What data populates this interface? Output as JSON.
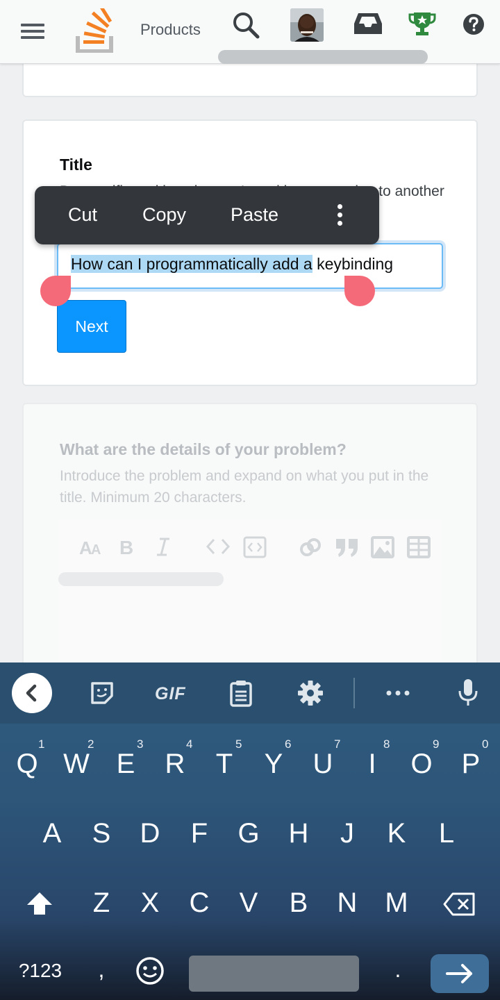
{
  "topbar": {
    "products_label": "Products",
    "icons": [
      "hamburger-menu-icon",
      "stackoverflow-logo",
      "search-icon",
      "user-avatar",
      "inbox-icon",
      "trophy-icon",
      "help-icon"
    ]
  },
  "title_section": {
    "heading": "Title",
    "description": "Be specific and imagine you're asking a question to another person.",
    "input_value_selected": "How can I programmatically add a",
    "input_value_rest": " keybinding",
    "next_label": "Next"
  },
  "context_menu": {
    "items": [
      "Cut",
      "Copy",
      "Paste"
    ],
    "more_icon": "more-vertical-icon"
  },
  "details_section": {
    "heading": "What are the details of your problem?",
    "description": "Introduce the problem and expand on what you put in the title. Minimum 20 characters.",
    "toolbar_icons": [
      "text-size-icon",
      "bold-icon",
      "italic-icon",
      "code-icon",
      "code-block-icon",
      "link-icon",
      "quote-icon",
      "image-icon",
      "table-icon"
    ]
  },
  "keyboard": {
    "toolbar_icons": [
      "back-icon",
      "sticker-icon",
      "gif-icon",
      "clipboard-icon",
      "settings-icon",
      "more-icon",
      "mic-icon"
    ],
    "gif_label": "GIF",
    "row1": [
      "Q",
      "W",
      "E",
      "R",
      "T",
      "Y",
      "U",
      "I",
      "O",
      "P"
    ],
    "row1_digits": [
      "1",
      "2",
      "3",
      "4",
      "5",
      "6",
      "7",
      "8",
      "9",
      "0"
    ],
    "row2": [
      "A",
      "S",
      "D",
      "F",
      "G",
      "H",
      "J",
      "K",
      "L"
    ],
    "row3": [
      "Z",
      "X",
      "C",
      "V",
      "B",
      "N",
      "M"
    ],
    "symbols_label": "?123",
    "comma": ",",
    "period": "."
  },
  "colors": {
    "accent": "#0a95ff",
    "selection": "#aed9f5",
    "handle": "#f56a78",
    "context_menu_bg": "#33363b",
    "keyboard_top": "#2f5a7f"
  }
}
